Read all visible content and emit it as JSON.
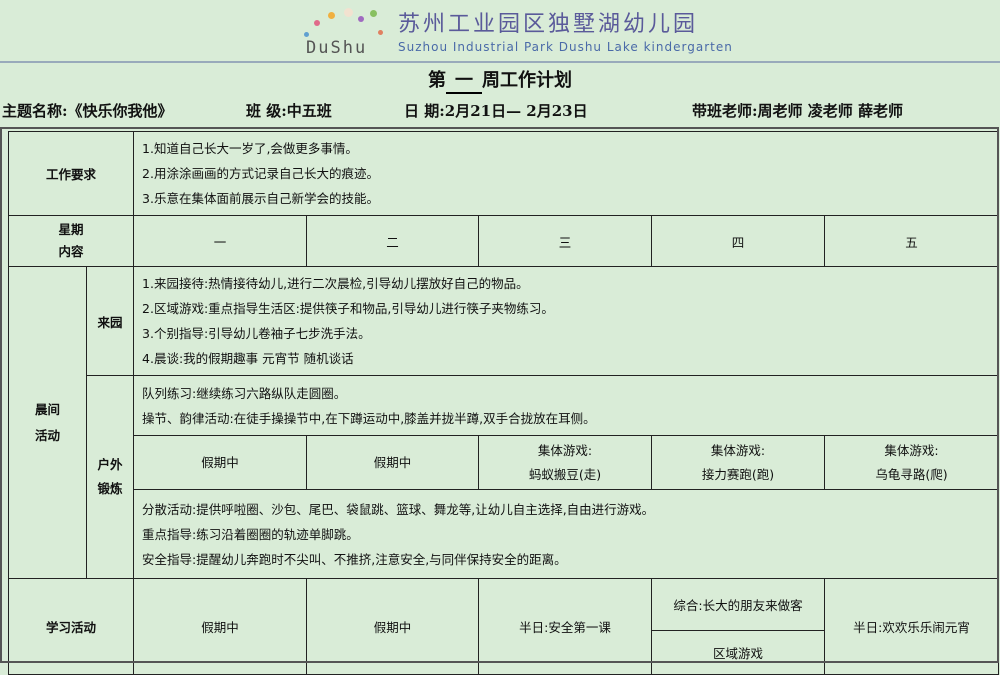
{
  "header": {
    "logo_text": "DuShu",
    "school_cn": "苏州工业园区独墅湖幼儿园",
    "school_en": "Suzhou Industrial Park Dushu Lake kindergarten"
  },
  "title": {
    "prefix": "第",
    "week_no": "一",
    "suffix": "周工作计划"
  },
  "info": {
    "theme": "主题名称:《快乐你我他》",
    "class": "班  级:中五班",
    "date": "日  期:2月21日— 2月23日",
    "teachers": "带班老师:周老师  凌老师  薛老师"
  },
  "table": {
    "work_req_label": "工作要求",
    "work_req": [
      "1.知道自己长大一岁了,会做更多事情。",
      "2.用涂涂画画的方式记录自己长大的痕迹。",
      "3.乐意在集体面前展示自己新学会的技能。"
    ],
    "weekday_label_1": "星期",
    "weekday_label_2": "内容",
    "weekdays": [
      "一",
      "二",
      "三",
      "四",
      "五"
    ],
    "morning_label_1": "晨间",
    "morning_label_2": "活动",
    "arrival_label": "来园",
    "arrival": [
      "1.来园接待:热情接待幼儿,进行二次晨检,引导幼儿摆放好自己的物品。",
      "2.区域游戏:重点指导生活区:提供筷子和物品,引导幼儿进行筷子夹物练习。",
      "3.个别指导:引导幼儿卷袖子七步洗手法。",
      "4.晨谈:我的假期趣事   元宵节   随机谈话"
    ],
    "outdoor_label_1": "户外",
    "outdoor_label_2": "锻炼",
    "outdoor_top": [
      "队列练习:继续练习六路纵队走圆圈。",
      "操节、韵律活动:在徒手操操节中,在下蹲运动中,膝盖并拢半蹲,双手合拢放在耳侧。"
    ],
    "outdoor_games": [
      {
        "line1": "假期中",
        "line2": ""
      },
      {
        "line1": "假期中",
        "line2": ""
      },
      {
        "line1": "集体游戏:",
        "line2": "蚂蚁搬豆(走)"
      },
      {
        "line1": "集体游戏:",
        "line2": "接力赛跑(跑)"
      },
      {
        "line1": "集体游戏:",
        "line2": "乌龟寻路(爬)"
      }
    ],
    "outdoor_bottom": [
      "分散活动:提供呼啦圈、沙包、尾巴、袋鼠跳、篮球、舞龙等,让幼儿自主选择,自由进行游戏。",
      "重点指导:练习沿着圈圈的轨迹单脚跳。",
      "安全指导:提醒幼儿奔跑时不尖叫、不推挤,注意安全,与同伴保持安全的距离。"
    ],
    "study_label": "学习活动",
    "study": [
      "假期中",
      "假期中",
      "半日:安全第一课",
      "综合:长大的朋友来做客",
      "半日:欢欢乐乐闹元宵"
    ],
    "study_thu_extra": "区域游戏"
  },
  "colors": {
    "background": "#d9ecd7",
    "school_name": "#5a5a9a",
    "school_en": "#4a6aa8"
  }
}
